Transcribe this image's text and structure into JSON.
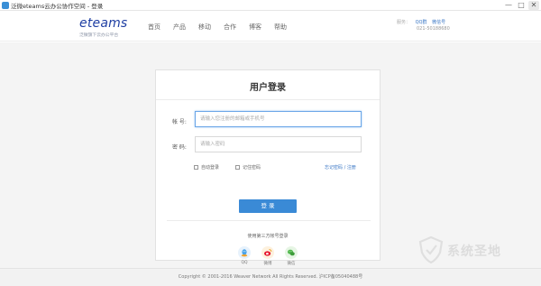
{
  "window": {
    "title": "泛微eteams云办公协作空间 - 登录",
    "controls": {
      "minimize": "—",
      "maximize": "□",
      "close": "✕"
    }
  },
  "header": {
    "logo": "eteams",
    "slogan": "泛微旗下云办公平台",
    "nav": [
      "首页",
      "产品",
      "移动",
      "合作",
      "博客",
      "帮助"
    ],
    "contact_label": "服务：",
    "qq_group": "QQ群",
    "wechat": "微信号",
    "phone": "021-50188680"
  },
  "login": {
    "title": "用户登录",
    "account_label": "帐 号:",
    "account_placeholder": "请输入您注册的邮箱或手机号",
    "password_label": "密 码:",
    "password_placeholder": "请输入密码",
    "auto_login": "自动登录",
    "remember_password": "记住密码",
    "forgot_link": "忘记密码 / 注册",
    "submit": "登 录"
  },
  "third_party": {
    "title": "使用第三方帐号登录",
    "items": [
      {
        "label": "QQ",
        "icon": "qq-icon",
        "color": "#4aa3e8"
      },
      {
        "label": "微博",
        "icon": "weibo-icon",
        "color": "#f0a02a"
      },
      {
        "label": "微信",
        "icon": "wechat-icon",
        "color": "#4cb648"
      }
    ]
  },
  "footer": {
    "copyright": "Copyright © 2001-2016 Weaver Network All Rights Reserved. 沪ICP备05040488号"
  },
  "watermark": {
    "text": "系统圣地",
    "icon": "shield-icon"
  },
  "colors": {
    "brand": "#1f3fa3",
    "accent": "#3a8ad6",
    "background": "#f4f4f4"
  }
}
